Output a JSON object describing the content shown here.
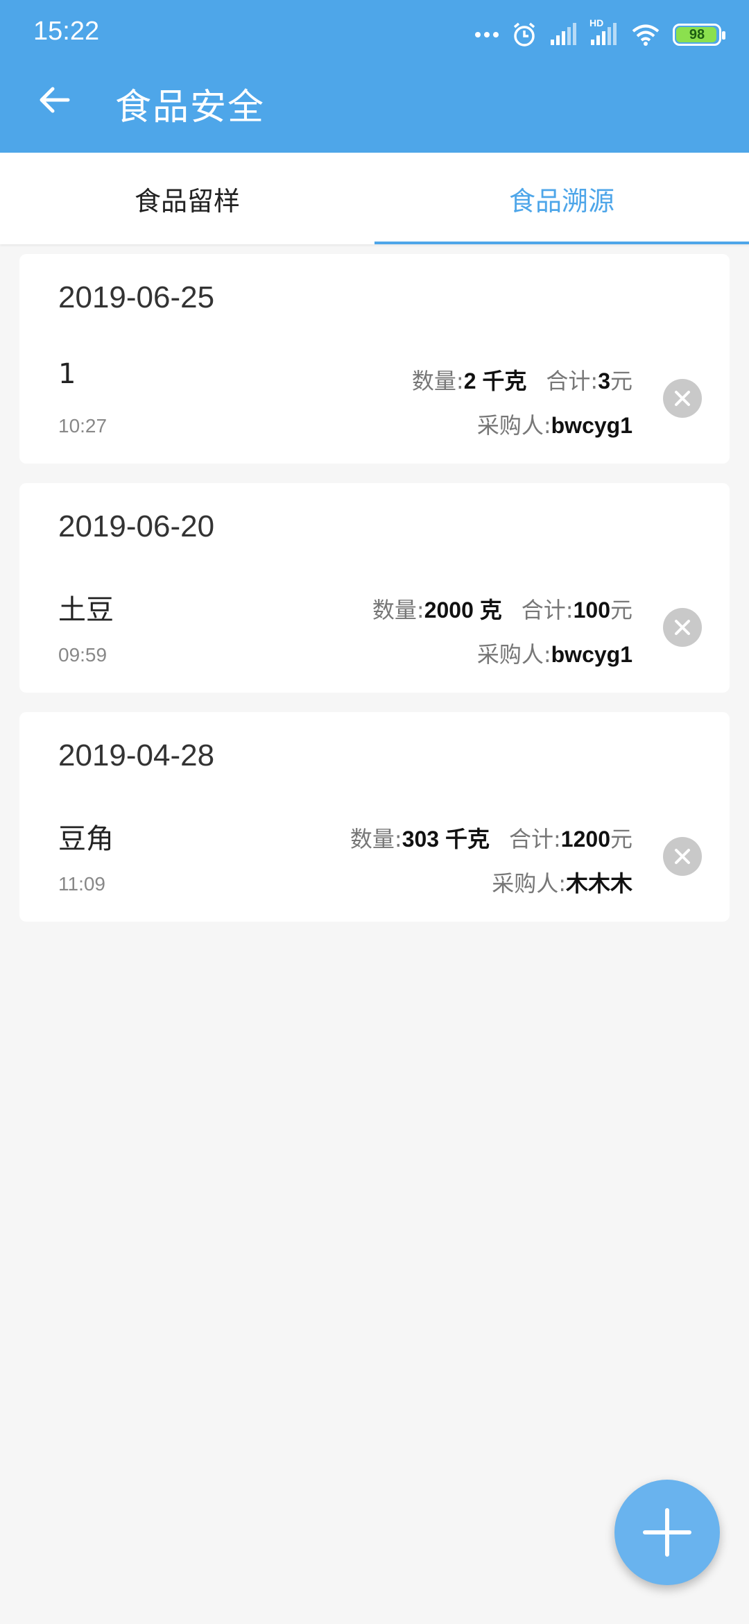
{
  "status_bar": {
    "time": "15:22",
    "icons": [
      "more-dots-icon",
      "alarm-icon",
      "signal-icon",
      "hd-signal-icon",
      "wifi-icon",
      "battery-icon"
    ],
    "hd_label": "HD",
    "battery_level": "98"
  },
  "app_bar": {
    "title": "食品安全",
    "back_icon": "arrow-left-icon",
    "background": "#4ea6e9"
  },
  "tabs": [
    {
      "label": "食品留样",
      "active": false
    },
    {
      "label": "食品溯源",
      "active": true
    }
  ],
  "records": [
    {
      "date": "2019-06-25",
      "name": "1",
      "time": "10:27",
      "qty_label": "数量:",
      "qty_value": "2 千克",
      "total_label": "合计:",
      "total_value": "3",
      "currency": "元",
      "buyer_label": "采购人:",
      "buyer": "bwcyg1"
    },
    {
      "date": "2019-06-20",
      "name": "土豆",
      "time": "09:59",
      "qty_label": "数量:",
      "qty_value": "2000 克",
      "total_label": "合计:",
      "total_value": "100",
      "currency": "元",
      "buyer_label": "采购人:",
      "buyer": "bwcyg1"
    },
    {
      "date": "2019-04-28",
      "name": "豆角",
      "time": "11:09",
      "qty_label": "数量:",
      "qty_value": "303 千克",
      "total_label": "合计:",
      "total_value": "1200",
      "currency": "元",
      "buyer_label": "采购人:",
      "buyer": "木木木"
    }
  ],
  "fab": {
    "icon": "plus-icon",
    "color": "#69b3ee"
  }
}
